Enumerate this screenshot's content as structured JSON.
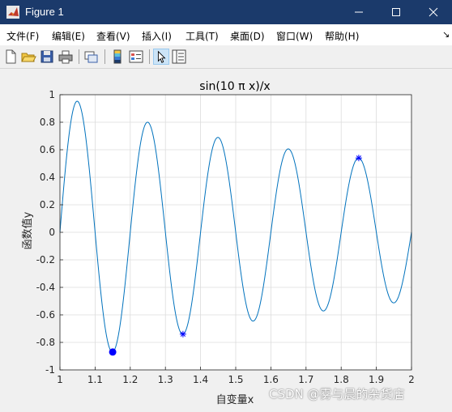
{
  "window": {
    "title": "Figure 1"
  },
  "menu": [
    "文件(F)",
    "编辑(E)",
    "查看(V)",
    "插入(I)",
    "工具(T)",
    "桌面(D)",
    "窗口(W)",
    "帮助(H)"
  ],
  "toolbar": [
    "new-figure",
    "open-file",
    "save",
    "print",
    "link-plot",
    "insert-colorbar",
    "insert-legend",
    "edit-plot",
    "property-inspector"
  ],
  "chart_data": {
    "type": "line",
    "title": "sin(10 π x)/x",
    "xlabel": "自变量x",
    "ylabel": "函数值y",
    "function": "sin(10*pi*x)/x",
    "xlim": [
      1,
      2
    ],
    "ylim": [
      -1,
      1
    ],
    "xticks": [
      "1",
      "1.1",
      "1.2",
      "1.3",
      "1.4",
      "1.5",
      "1.6",
      "1.7",
      "1.8",
      "1.9",
      "2"
    ],
    "yticks": [
      "-1",
      "-0.8",
      "-0.6",
      "-0.4",
      "-0.2",
      "0",
      "0.2",
      "0.4",
      "0.6",
      "0.8",
      "1"
    ],
    "grid": true,
    "line_color": "#0072bd",
    "markers": [
      {
        "x": 1.15,
        "y": -0.87,
        "symbol": "circle",
        "color": "#0000ff"
      },
      {
        "x": 1.35,
        "y": -0.74,
        "symbol": "asterisk",
        "color": "#0000ff"
      },
      {
        "x": 1.85,
        "y": 0.54,
        "symbol": "asterisk",
        "color": "#0000ff"
      }
    ]
  },
  "watermark": "CSDN @雾与晨的杂货店"
}
